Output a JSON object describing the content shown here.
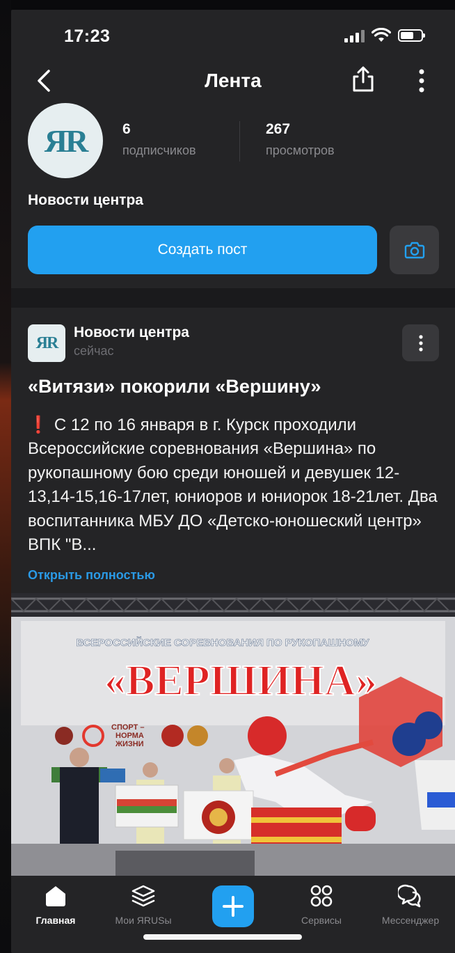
{
  "status_bar": {
    "time": "17:23"
  },
  "nav": {
    "title": "Лента"
  },
  "profile": {
    "logo_text": "ЯR",
    "subscribers_count": "6",
    "subscribers_label": "подписчиков",
    "views_count": "267",
    "views_label": "просмотров",
    "channel_name": "Новости центра",
    "create_post_label": "Создать пост"
  },
  "post": {
    "author": "Новости центра",
    "time": "сейчас",
    "title": "«Витязи» покорили «Вершину»",
    "body_icon": "❗",
    "body": "С 12 по 16 января в г. Курск проходили Всероссийские соревнования «Вершина» по рукопашному бою среди юношей и девушек 12-13,14-15,16-17лет, юниоров и юниорок 18-21лет.  Два воспитанника МБУ ДО «Детско-юношеский центр»  ВПК \"В...",
    "open_full_label": "Открыть полностью",
    "photo": {
      "banner_top": "ВСЕРОССИЙСКИЕ СОРЕВНОВАНИЯ ПО РУКОПАШНОМУ",
      "banner_main": "«ВЕРШИНА»",
      "sponsor_text": [
        "СПОРТ –",
        "НОРМА",
        "ЖИЗНИ"
      ]
    }
  },
  "tabbar": {
    "items": [
      {
        "label": "Главная",
        "icon": "home-icon",
        "active": true
      },
      {
        "label": "Мои ЯRUSы",
        "icon": "layers-icon",
        "active": false
      },
      {
        "label": "",
        "icon": "plus-icon",
        "active": false
      },
      {
        "label": "Сервисы",
        "icon": "grid-icon",
        "active": false
      },
      {
        "label": "Мессенджер",
        "icon": "chat-icon",
        "active": false
      }
    ]
  },
  "colors": {
    "background": "#242426",
    "accent": "#22a0f0",
    "link": "#2a9ae6",
    "logo": "#2a7f94"
  }
}
